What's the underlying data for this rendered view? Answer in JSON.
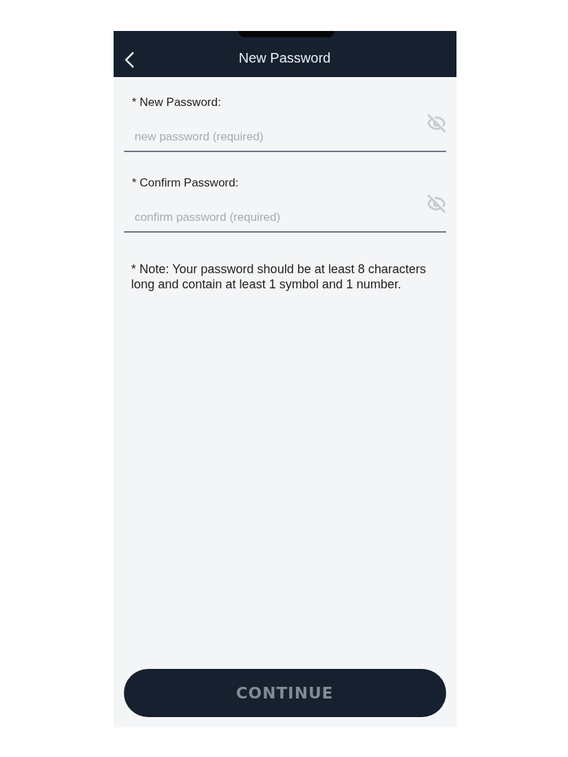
{
  "header": {
    "title": "New Password"
  },
  "fields": [
    {
      "label": "* New Password:",
      "placeholder": "new password (required)",
      "visible": false
    },
    {
      "label": "* Confirm Password:",
      "placeholder": "confirm password (required)",
      "visible": false
    }
  ],
  "note": "* Note: Your password should be at least 8 characters long and contain at least 1 symbol and 1 number.",
  "continue_button": {
    "label": "CONTINUE",
    "disabled": true
  }
}
